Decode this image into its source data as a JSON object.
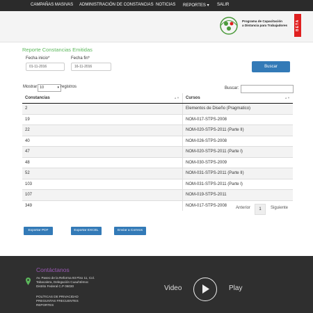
{
  "nav": {
    "items": [
      "CAMPAÑAS MASIVAS",
      "ADMINISTRACIÓN DE CONSTANCIAS",
      "NOTICIAS",
      "REPORTES",
      "SALIR"
    ],
    "reportes_caret": "▾"
  },
  "logo": {
    "line1": "Programa de Capacitación",
    "line2": "a Distancia para Trabajadores",
    "badge": "BETA"
  },
  "report": {
    "title": "Reporte Constancias Emitidas",
    "fecha_inicio_label": "Fecha inicio*",
    "fecha_inicio_value": "01-11-2016",
    "fecha_fin_label": "Fecha fin*",
    "fecha_fin_value": "16-11-2016",
    "buscar_label": "Buscar"
  },
  "table_controls": {
    "mostrar": "Mostrar",
    "page_size": "10",
    "registros": "registros",
    "buscar": "Buscar:"
  },
  "table": {
    "headers": [
      "Constancias",
      "Cursos"
    ],
    "rows": [
      [
        "2",
        "Elementos de Diseño (Pragmatico)"
      ],
      [
        "19",
        "NOM-017-STPS-2008"
      ],
      [
        "22",
        "NOM-020-STPS-2011 (Parte II)"
      ],
      [
        "40",
        "NOM-026-STPS-2008"
      ],
      [
        "47",
        "NOM-020-STPS-2011 (Parte I)"
      ],
      [
        "48",
        "NOM-030-STPS-2009"
      ],
      [
        "52",
        "NOM-031-STPS-2011 (Parte II)"
      ],
      [
        "103",
        "NOM-031-STPS-2011 (Parte I)"
      ],
      [
        "107",
        "NOM-019-STPS-2011"
      ],
      [
        "349",
        "NOM-017-STPS-2008"
      ]
    ]
  },
  "pagination": {
    "prev": "Anterior",
    "page": "1",
    "next": "Siguiente"
  },
  "export": {
    "pdf": "Exportar PDF",
    "excel": "Exportar EXCEL",
    "email": "Enviar a Correos"
  },
  "footer": {
    "title": "Contáctanos",
    "address": [
      "Av. Paseo de la Reforma 93 Piso 11, Col.",
      "Tabacalera, Delegación Cuauhtémoc",
      "Distrito Federal C.P 06030"
    ],
    "links": [
      "POLÍTICAS DE PRIVACIDAD",
      "PREGUNTAS FRECUENTES",
      "REPORTES"
    ],
    "video_left": "Video",
    "video_right": "Play"
  },
  "colors": {
    "navbar": "#2b2b2b",
    "accent_green": "#5cb85c",
    "button_blue": "#337ab7",
    "beta_red": "#e02020",
    "footer": "#2f2f2f",
    "footer_title": "#9b59b6"
  },
  "icons": [
    "logo-emblem-icon",
    "location-pin-icon",
    "play-icon",
    "sort-icon"
  ]
}
